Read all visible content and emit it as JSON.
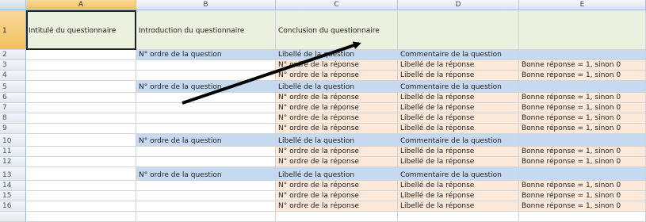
{
  "columns": [
    "A",
    "B",
    "C",
    "D",
    "E"
  ],
  "row1": {
    "number": "1",
    "a": "Intitulé du questionnaire",
    "b": "Introduction du questionnaire",
    "c": "Conclusion du questionnaire"
  },
  "question_rows": [
    {
      "number": "2",
      "b": "N° ordre de la question",
      "c": "Libellé de la question",
      "d": "Commentaire de la question"
    },
    {
      "number": "5",
      "b": "N° ordre de la question",
      "c": "Libellé de la question",
      "d": "Commentaire de la question"
    },
    {
      "number": "10",
      "b": "N° ordre de la question",
      "c": "Libellé de la question",
      "d": "Commentaire de la question"
    },
    {
      "number": "13",
      "b": "N° ordre de la question",
      "c": "Libellé de la question",
      "d": "Commentaire de la question"
    }
  ],
  "answer_rows": [
    {
      "number": "3",
      "c": "N° ordre de la réponse",
      "d": "Libellé de la réponse",
      "e": "Bonne réponse = 1, sinon 0"
    },
    {
      "number": "4",
      "c": "N° ordre de la réponse",
      "d": "Libellé de la réponse",
      "e": "Bonne réponse = 1, sinon 0"
    },
    {
      "number": "6",
      "c": "N° ordre de la réponse",
      "d": "Libellé de la réponse",
      "e": "Bonne réponse = 1, sinon 0"
    },
    {
      "number": "7",
      "c": "N° ordre de la réponse",
      "d": "Libellé de la réponse",
      "e": "Bonne réponse = 1, sinon 0"
    },
    {
      "number": "8",
      "c": "N° ordre de la réponse",
      "d": "Libellé de la réponse",
      "e": "Bonne réponse = 1, sinon 0"
    },
    {
      "number": "9",
      "c": "N° ordre de la réponse",
      "d": "Libellé de la réponse",
      "e": "Bonne réponse = 1, sinon 0"
    },
    {
      "number": "11",
      "c": "N° ordre de la réponse",
      "d": "Libellé de la réponse",
      "e": "Bonne réponse = 1, sinon 0"
    },
    {
      "number": "12",
      "c": "N° ordre de la réponse",
      "d": "Libellé de la réponse",
      "e": "Bonne réponse = 1, sinon 0"
    },
    {
      "number": "14",
      "c": "N° ordre de la réponse",
      "d": "Libellé de la réponse",
      "e": "Bonne réponse = 1, sinon 0"
    },
    {
      "number": "15",
      "c": "N° ordre de la réponse",
      "d": "Libellé de la réponse",
      "e": "Bonne réponse = 1, sinon 0"
    },
    {
      "number": "16",
      "c": "N° ordre de la réponse",
      "d": "Libellé de la réponse",
      "e": "Bonne réponse = 1, sinon 0"
    }
  ],
  "colors": {
    "header_row": "#ebf1de",
    "question_row": "#c5d9f1",
    "answer_row": "#fde9d9",
    "arrow": "#000000"
  },
  "annotation": {
    "icon": "arrow-annotation-icon"
  }
}
